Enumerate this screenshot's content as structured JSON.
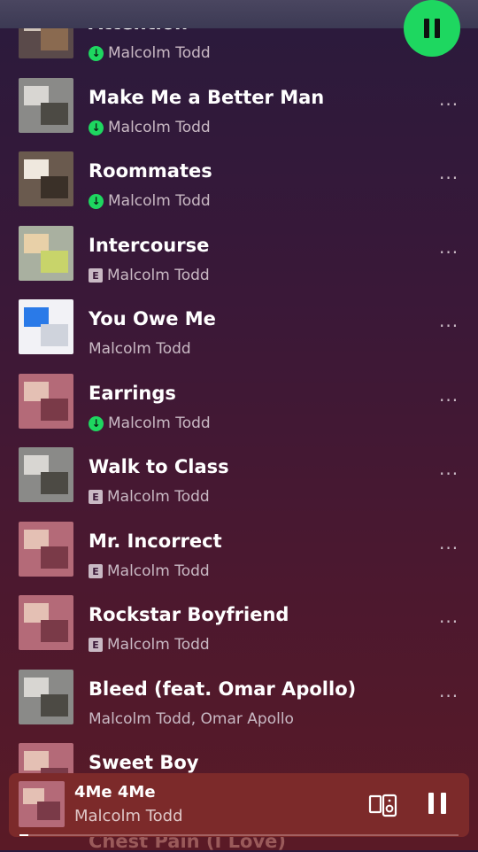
{
  "tracks": [
    {
      "title": "Attention",
      "artist": "Malcolm Todd",
      "badge": "downloaded",
      "more": "···",
      "art_colors": [
        "#5a4a4a",
        "#cfc3b8",
        "#8a6a50"
      ]
    },
    {
      "title": "Make Me a Better Man",
      "artist": "Malcolm Todd",
      "badge": "downloaded",
      "more": "···",
      "art_colors": [
        "#8a8a88",
        "#d8d6d2",
        "#4c4a44"
      ]
    },
    {
      "title": "Roommates",
      "artist": "Malcolm Todd",
      "badge": "downloaded",
      "more": "···",
      "art_colors": [
        "#6a5a4e",
        "#efe8de",
        "#3a3028"
      ]
    },
    {
      "title": "Intercourse",
      "artist": "Malcolm Todd",
      "badge": "explicit",
      "more": "···",
      "art_colors": [
        "#a9b0a0",
        "#e8d0a8",
        "#c8d46a"
      ]
    },
    {
      "title": "You Owe Me",
      "artist": "Malcolm Todd",
      "badge": "none",
      "more": "···",
      "art_colors": [
        "#f2f2f6",
        "#2a7ae8",
        "#cfd3dc"
      ]
    },
    {
      "title": "Earrings",
      "artist": "Malcolm Todd",
      "badge": "downloaded",
      "more": "···",
      "art_colors": [
        "#b46a78",
        "#e4c0b4",
        "#7a3a48"
      ]
    },
    {
      "title": "Walk to Class",
      "artist": "Malcolm Todd",
      "badge": "explicit",
      "more": "···",
      "art_colors": [
        "#8a8a88",
        "#d8d6d2",
        "#4c4a44"
      ]
    },
    {
      "title": "Mr. Incorrect",
      "artist": "Malcolm Todd",
      "badge": "explicit",
      "more": "···",
      "art_colors": [
        "#b46a78",
        "#e4c0b4",
        "#7a3a48"
      ]
    },
    {
      "title": "Rockstar Boyfriend",
      "artist": "Malcolm Todd",
      "badge": "explicit",
      "more": "···",
      "art_colors": [
        "#b46a78",
        "#e4c0b4",
        "#7a3a48"
      ]
    },
    {
      "title": "Bleed (feat. Omar Apollo)",
      "artist": "Malcolm Todd, Omar Apollo",
      "badge": "none",
      "more": "···",
      "art_colors": [
        "#8a8a88",
        "#d8d6d2",
        "#4c4a44"
      ]
    },
    {
      "title": "Sweet Boy",
      "artist": "",
      "badge": "none",
      "more": "",
      "art_colors": [
        "#b46a78",
        "#e4c0b4",
        "#7a3a48"
      ]
    }
  ],
  "badges": {
    "downloaded_glyph": "↓",
    "explicit_glyph": "E"
  },
  "peek_title": "Chest Pain (I Love)",
  "now_playing": {
    "title": "4Me 4Me",
    "artist": "Malcolm Todd",
    "progress": 0.02,
    "art_colors": [
      "#b46a78",
      "#e4c0b4",
      "#7a3a48"
    ]
  },
  "colors": {
    "accent": "#1ed760",
    "mini_player_bg": "#7c2a2a"
  },
  "icons": {
    "play_pause": "pause-icon",
    "device": "connect-device-icon",
    "mini_pause": "pause-icon"
  }
}
